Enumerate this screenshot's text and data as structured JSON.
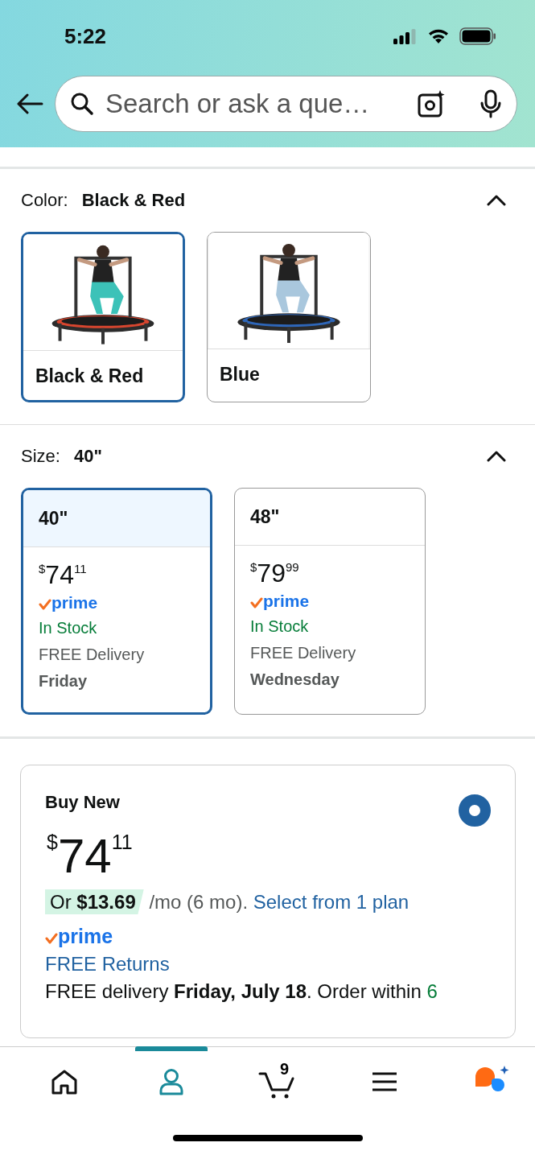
{
  "status_bar": {
    "time": "5:22"
  },
  "search": {
    "placeholder": "Search or ask a que…"
  },
  "color": {
    "label": "Color:",
    "value": "Black & Red",
    "expanded": true,
    "options": [
      {
        "name": "Black & Red",
        "selected": true,
        "kind": "picture"
      },
      {
        "name": "Blue",
        "selected": false,
        "kind": "picture"
      }
    ]
  },
  "size": {
    "label": "Size:",
    "value": "40\"",
    "expanded": true,
    "options": [
      {
        "name": "40\"",
        "selected": true,
        "currency": "$",
        "price_whole": "74",
        "price_fraction": "11",
        "prime": "prime",
        "stock": "In Stock",
        "delivery": "FREE Delivery",
        "day": "Friday"
      },
      {
        "name": "48\"",
        "selected": false,
        "currency": "$",
        "price_whole": "79",
        "price_fraction": "99",
        "prime": "prime",
        "stock": "In Stock",
        "delivery": "FREE Delivery",
        "day": "Wednesday"
      }
    ]
  },
  "buy_new": {
    "title": "Buy New",
    "selected": true,
    "currency": "$",
    "price_whole": "74",
    "price_fraction": "11",
    "installment": "Or **$13.69**",
    "installment_term": "/mo (6 mo).",
    "plan_link": "Select from 1 plan",
    "prime": "prime",
    "returns": "FREE Returns",
    "delivery": "FREE delivery **Friday, July 18**. Order within",
    "countdown": "6"
  },
  "nav": {
    "items": [
      {
        "kind": "home",
        "selected": false
      },
      {
        "kind": "account",
        "selected": true
      },
      {
        "kind": "cart",
        "selected": false,
        "badge": "9"
      },
      {
        "kind": "menu",
        "selected": false
      },
      {
        "kind": "assistant",
        "selected": false
      }
    ]
  }
}
